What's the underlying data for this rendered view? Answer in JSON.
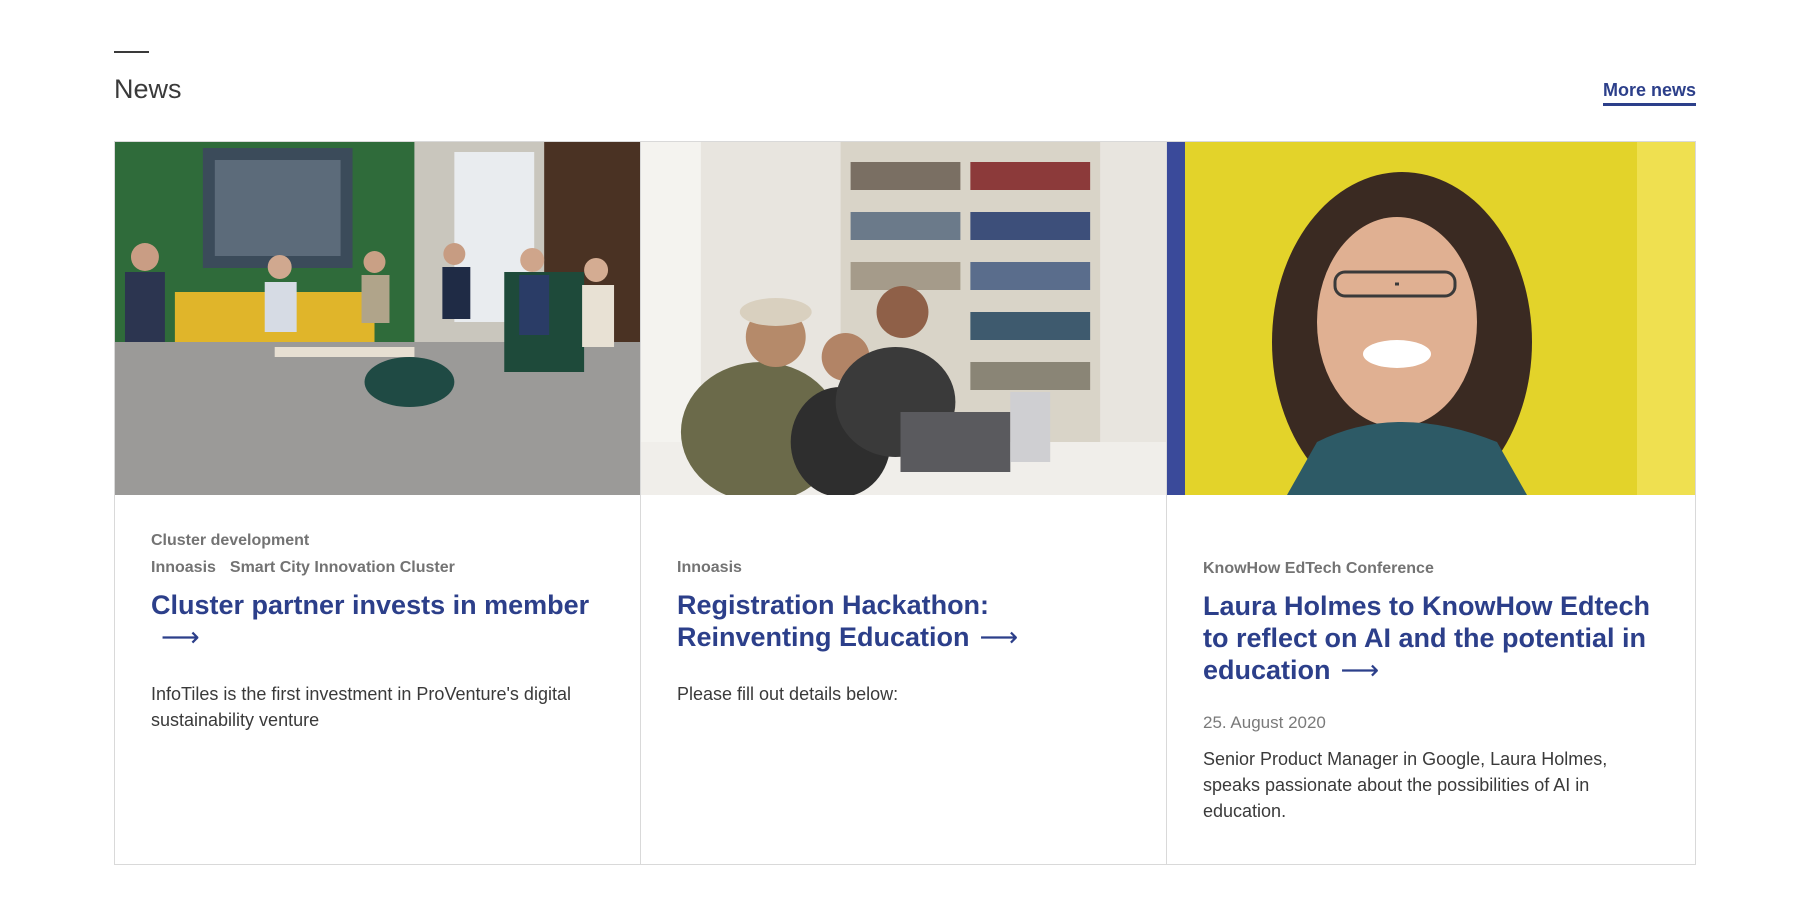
{
  "news": {
    "title": "News",
    "more_label": "More news",
    "cards": [
      {
        "category": "Cluster development",
        "tags": [
          "Innoasis",
          "Smart City Innovation Cluster"
        ],
        "title": "Cluster partner invests in member",
        "arrow": "⟶",
        "date": "",
        "description": "InfoTiles is the first investment in ProVenture's digital sustainability venture",
        "image": "photo-meeting-room"
      },
      {
        "category": "",
        "tags": [
          "Innoasis"
        ],
        "title": "Registration Hackathon: Reinventing Education",
        "arrow": "⟶",
        "date": "",
        "description": "Please fill out details below:",
        "image": "photo-library-students"
      },
      {
        "category": "KnowHow EdTech Conference",
        "tags": [],
        "title": "Laura Holmes to KnowHow Edtech to reflect on AI and the potential in education",
        "arrow": "⟶",
        "date": "25. August 2020",
        "description": "Senior Product Manager in Google, Laura Holmes, speaks passionate about the possibilities of AI in education.",
        "image": "photo-portrait-woman"
      }
    ]
  },
  "colors": {
    "accent": "#2c3f8a",
    "meta": "#737373",
    "border": "#d9d9d9"
  }
}
